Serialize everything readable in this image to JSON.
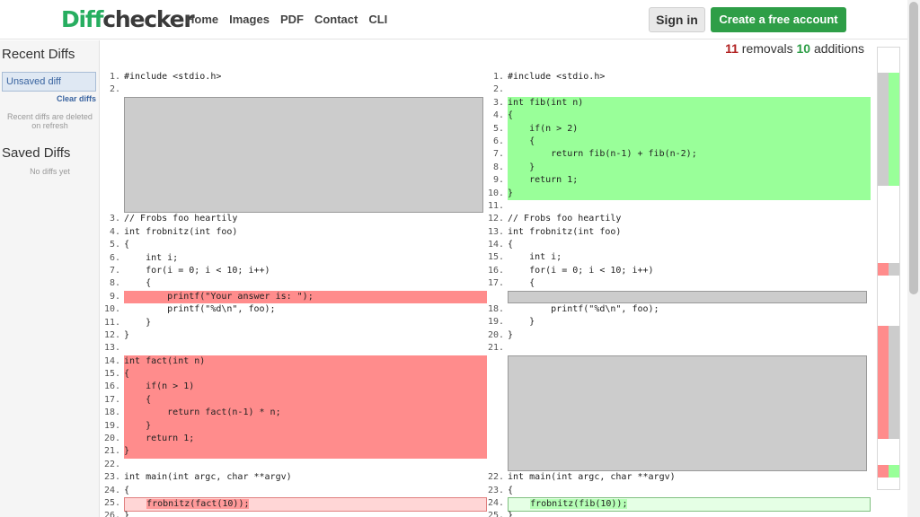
{
  "logo": {
    "part1": "Diff",
    "part2": "checker"
  },
  "nav": [
    "Home",
    "Images",
    "PDF",
    "Contact",
    "CLI"
  ],
  "signin_label": "Sign in",
  "create_label": "Create a free account",
  "counts": {
    "removals": "11",
    "removals_label": " removals ",
    "additions": "10",
    "additions_label": " additions"
  },
  "sidebar": {
    "recent_title": "Recent Diffs",
    "unsaved": "Unsaved diff",
    "clear": "Clear diffs",
    "note": "Recent diffs are deleted on refresh",
    "saved_title": "Saved Diffs",
    "no_diffs": "No diffs yet"
  },
  "left_lines": [
    {
      "n": "1.",
      "code": "#include <stdio.h>",
      "type": "normal"
    },
    {
      "n": "2.",
      "code": "",
      "type": "normal"
    },
    {
      "n": "3.",
      "code": "// Frobs foo heartily",
      "type": "normal"
    },
    {
      "n": "4.",
      "code": "int frobnitz(int foo)",
      "type": "normal"
    },
    {
      "n": "5.",
      "code": "{",
      "type": "normal"
    },
    {
      "n": "6.",
      "code": "    int i;",
      "type": "normal"
    },
    {
      "n": "7.",
      "code": "    for(i = 0; i < 10; i++)",
      "type": "normal"
    },
    {
      "n": "8.",
      "code": "    {",
      "type": "normal"
    },
    {
      "n": "9.",
      "code": "        printf(\"Your answer is: \");",
      "type": "removed"
    },
    {
      "n": "10.",
      "code": "        printf(\"%d\\n\", foo);",
      "type": "normal"
    },
    {
      "n": "11.",
      "code": "    }",
      "type": "normal"
    },
    {
      "n": "12.",
      "code": "}",
      "type": "normal"
    },
    {
      "n": "13.",
      "code": "",
      "type": "normal"
    },
    {
      "n": "14.",
      "code": "int fact(int n)",
      "type": "removed"
    },
    {
      "n": "15.",
      "code": "{",
      "type": "removed"
    },
    {
      "n": "16.",
      "code": "    if(n > 1)",
      "type": "removed"
    },
    {
      "n": "17.",
      "code": "    {",
      "type": "removed"
    },
    {
      "n": "18.",
      "code": "        return fact(n-1) * n;",
      "type": "removed"
    },
    {
      "n": "19.",
      "code": "    }",
      "type": "removed"
    },
    {
      "n": "20.",
      "code": "    return 1;",
      "type": "removed"
    },
    {
      "n": "21.",
      "code": "}",
      "type": "removed"
    },
    {
      "n": "22.",
      "code": "",
      "type": "removed"
    },
    {
      "n": "23.",
      "code": "int main(int argc, char **argv)",
      "type": "normal"
    },
    {
      "n": "24.",
      "code": "{",
      "type": "normal"
    },
    {
      "n": "25.",
      "code": "    frobnitz(fact(10));",
      "type": "changed-removed"
    },
    {
      "n": "26.",
      "code": "}",
      "type": "normal"
    }
  ],
  "right_lines": [
    {
      "n": "1.",
      "code": "#include <stdio.h>",
      "type": "normal"
    },
    {
      "n": "2.",
      "code": "",
      "type": "normal"
    },
    {
      "n": "3.",
      "code": "int fib(int n)",
      "type": "added"
    },
    {
      "n": "4.",
      "code": "{",
      "type": "added"
    },
    {
      "n": "5.",
      "code": "    if(n > 2)",
      "type": "added"
    },
    {
      "n": "6.",
      "code": "    {",
      "type": "added"
    },
    {
      "n": "7.",
      "code": "        return fib(n-1) + fib(n-2);",
      "type": "added"
    },
    {
      "n": "8.",
      "code": "    }",
      "type": "added"
    },
    {
      "n": "9.",
      "code": "    return 1;",
      "type": "added"
    },
    {
      "n": "10.",
      "code": "}",
      "type": "added"
    },
    {
      "n": "11.",
      "code": "",
      "type": "added"
    },
    {
      "n": "12.",
      "code": "// Frobs foo heartily",
      "type": "normal"
    },
    {
      "n": "13.",
      "code": "int frobnitz(int foo)",
      "type": "normal"
    },
    {
      "n": "14.",
      "code": "{",
      "type": "normal"
    },
    {
      "n": "15.",
      "code": "    int i;",
      "type": "normal"
    },
    {
      "n": "16.",
      "code": "    for(i = 0; i < 10; i++)",
      "type": "normal"
    },
    {
      "n": "17.",
      "code": "    {",
      "type": "normal"
    },
    {
      "n": "18.",
      "code": "        printf(\"%d\\n\", foo);",
      "type": "normal"
    },
    {
      "n": "19.",
      "code": "    }",
      "type": "normal"
    },
    {
      "n": "20.",
      "code": "}",
      "type": "normal"
    },
    {
      "n": "21.",
      "code": "",
      "type": "normal"
    },
    {
      "n": "22.",
      "code": "int main(int argc, char **argv)",
      "type": "normal"
    },
    {
      "n": "23.",
      "code": "{",
      "type": "normal"
    },
    {
      "n": "24.",
      "code": "    frobnitz(fib(10));",
      "type": "changed-added"
    },
    {
      "n": "25.",
      "code": "}",
      "type": "normal"
    }
  ],
  "colors": {
    "removed": "#ff8c8c",
    "added": "#99ff99",
    "placeholder": "#cccccc",
    "brand_green": "#2e9e47"
  }
}
